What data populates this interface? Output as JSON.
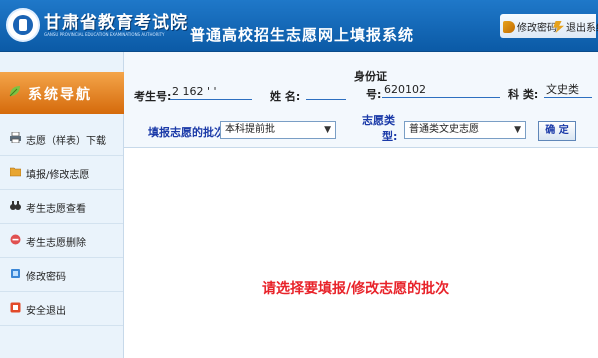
{
  "header": {
    "logo_title": "甘肃省教育考试院",
    "logo_subtitle": "GANSU PROVINCIAL EDUCATION EXAMINATIONS AUTHORITY",
    "system_title": "普通高校招生志愿网上填报系统",
    "change_password": "修改密码",
    "logout": "退出系统"
  },
  "sidebar": {
    "title": "系统导航",
    "items": [
      {
        "label": "志愿（样表）下载",
        "icon": "printer-icon"
      },
      {
        "label": "填报/修改志愿",
        "icon": "folder-icon"
      },
      {
        "label": "考生志愿查看",
        "icon": "binoculars-icon"
      },
      {
        "label": "考生志愿删除",
        "icon": "delete-icon"
      },
      {
        "label": "修改密码",
        "icon": "key-icon"
      },
      {
        "label": "安全退出",
        "icon": "exit-icon"
      }
    ]
  },
  "form": {
    "exam_no_label": "考生号:",
    "exam_no_value": "2 162 ' '",
    "name_label": "姓  名:",
    "name_value": "",
    "id_label_top": "身份证",
    "id_label_bottom": "号:",
    "id_value": "620102",
    "subject_label": "科  类:",
    "subject_value": "文史类",
    "batch_label": "填报志愿的批次:",
    "batch_selected": "本科提前批",
    "type_label_top": "志愿类",
    "type_label_bottom": "型:",
    "type_selected": "普通类文史志愿",
    "confirm": "确 定"
  },
  "main": {
    "message": "请选择要填报/修改志愿的批次"
  },
  "colors": {
    "header_blue": "#1f78c9",
    "nav_orange": "#e8832a",
    "message_red": "#e8232a",
    "label_blue": "#1b3aa8"
  }
}
